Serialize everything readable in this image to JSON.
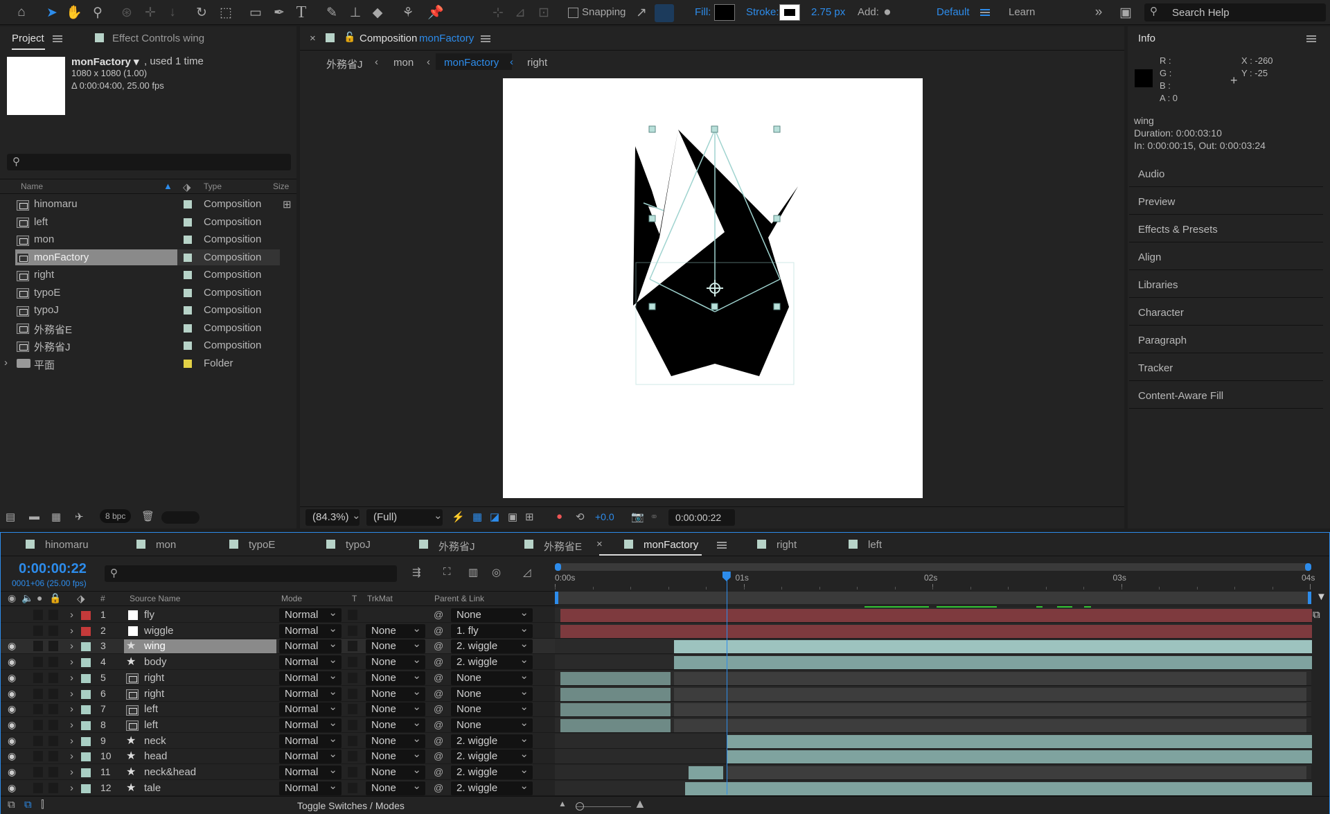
{
  "toolbar": {
    "snapping_label": "Snapping",
    "fill_label": "Fill:",
    "stroke_label": "Stroke:",
    "stroke_width": "2.75 px",
    "add_label": "Add:",
    "workspace": "Default",
    "learn_label": "Learn",
    "search_placeholder": "Search Help",
    "colors": {
      "accent": "#2d8ceb",
      "fill": "#000000",
      "stroke": "#ffffff"
    }
  },
  "project": {
    "tab_label": "Project",
    "effect_controls_label": "Effect Controls wing",
    "selected_name": "monFactory ▾",
    "used": ", used 1 time",
    "dims": "1080 x 1080 (1.00)",
    "duration": "Δ 0:00:04:00, 25.00 fps",
    "columns": {
      "name": "Name",
      "type": "Type",
      "size": "Size"
    },
    "items": [
      {
        "name": "hinomaru",
        "type": "Composition",
        "kind": "comp"
      },
      {
        "name": "left",
        "type": "Composition",
        "kind": "comp"
      },
      {
        "name": "mon",
        "type": "Composition",
        "kind": "comp"
      },
      {
        "name": "monFactory",
        "type": "Composition",
        "kind": "comp",
        "selected": true
      },
      {
        "name": "right",
        "type": "Composition",
        "kind": "comp"
      },
      {
        "name": "typoE",
        "type": "Composition",
        "kind": "comp"
      },
      {
        "name": "typoJ",
        "type": "Composition",
        "kind": "comp"
      },
      {
        "name": "外務省E",
        "type": "Composition",
        "kind": "comp"
      },
      {
        "name": "外務省J",
        "type": "Composition",
        "kind": "comp"
      },
      {
        "name": "平面",
        "type": "Folder",
        "kind": "folder"
      }
    ],
    "bpc": "8 bpc"
  },
  "composition": {
    "tab_prefix": "Composition",
    "tab_name": "monFactory",
    "breadcrumbs": [
      "外務省J",
      "mon",
      "monFactory",
      "right"
    ],
    "zoom": "(84.3%)",
    "resolution": "(Full)",
    "exposure": "+0.0",
    "timecode": "0:00:00:22"
  },
  "info": {
    "title": "Info",
    "r": "R :",
    "g": "G :",
    "b": "B :",
    "a": "A :  0",
    "x": "X : -260",
    "y": "Y :  -25",
    "layer": "wing",
    "duration": "Duration: 0:00:03:10",
    "inout": "In: 0:00:00:15, Out: 0:00:03:24",
    "panels": [
      "Audio",
      "Preview",
      "Effects & Presets",
      "Align",
      "Libraries",
      "Character",
      "Paragraph",
      "Tracker",
      "Content-Aware Fill"
    ]
  },
  "timeline": {
    "tabs": [
      "hinomaru",
      "mon",
      "typoE",
      "typoJ",
      "外務省J",
      "外務省E",
      "monFactory",
      "right",
      "left"
    ],
    "active_tab": "monFactory",
    "timecode": "0:00:00:22",
    "frame_info": "0001+06 (25.00 fps)",
    "columns": {
      "num": "#",
      "source": "Source Name",
      "mode": "Mode",
      "t": "T",
      "trkmat": "TrkMat",
      "parent": "Parent & Link"
    },
    "ruler": [
      "0:00s",
      "01s",
      "02s",
      "03s",
      "04s"
    ],
    "playhead_sec": 0.88,
    "duration_sec": 4,
    "toggle_label": "Toggle Switches / Modes",
    "layers": [
      {
        "num": "1",
        "name": "fly",
        "label_color": "#c43a3a",
        "icon": "solid",
        "mode": "Normal",
        "trkmat": "",
        "parent": "None",
        "visible": false,
        "start": 0,
        "end": 4,
        "bar_color": "#7e3a3e"
      },
      {
        "num": "2",
        "name": "wiggle",
        "label_color": "#c43a3a",
        "icon": "solid",
        "mode": "Normal",
        "trkmat": "None",
        "parent": "1. fly",
        "visible": false,
        "start": 0,
        "end": 4,
        "bar_color": "#7e3a3e"
      },
      {
        "num": "3",
        "name": "wing",
        "label_color": "#a9cfc4",
        "icon": "star",
        "mode": "Normal",
        "trkmat": "None",
        "parent": "2. wiggle",
        "visible": true,
        "selected": true,
        "start": 0.6,
        "end": 4,
        "bar_color": "#9dc3bf"
      },
      {
        "num": "4",
        "name": "body",
        "label_color": "#a9cfc4",
        "icon": "star",
        "mode": "Normal",
        "trkmat": "None",
        "parent": "2. wiggle",
        "visible": true,
        "start": 0.6,
        "end": 4,
        "bar_color": "#7fa39f"
      },
      {
        "num": "5",
        "name": "right",
        "label_color": "#a9cfc4",
        "icon": "comp",
        "mode": "Normal",
        "trkmat": "None",
        "parent": "None",
        "visible": true,
        "start": 0,
        "end": 0.6,
        "bar_color": "#6e8a86"
      },
      {
        "num": "6",
        "name": "right",
        "label_color": "#a9cfc4",
        "icon": "comp",
        "mode": "Normal",
        "trkmat": "None",
        "parent": "None",
        "visible": true,
        "start": 0,
        "end": 0.6,
        "bar_color": "#6e8a86"
      },
      {
        "num": "7",
        "name": "left",
        "label_color": "#a9cfc4",
        "icon": "comp",
        "mode": "Normal",
        "trkmat": "None",
        "parent": "None",
        "visible": true,
        "start": 0,
        "end": 0.6,
        "bar_color": "#6e8a86"
      },
      {
        "num": "8",
        "name": "left",
        "label_color": "#a9cfc4",
        "icon": "comp",
        "mode": "Normal",
        "trkmat": "None",
        "parent": "None",
        "visible": true,
        "start": 0,
        "end": 0.6,
        "bar_color": "#6e8a86"
      },
      {
        "num": "9",
        "name": "neck",
        "label_color": "#a9cfc4",
        "icon": "star",
        "mode": "Normal",
        "trkmat": "None",
        "parent": "2. wiggle",
        "visible": true,
        "start": 0.88,
        "end": 4,
        "bar_color": "#7fa39f"
      },
      {
        "num": "10",
        "name": "head",
        "label_color": "#a9cfc4",
        "icon": "star",
        "mode": "Normal",
        "trkmat": "None",
        "parent": "2. wiggle",
        "visible": true,
        "start": 0.88,
        "end": 4,
        "bar_color": "#7fa39f"
      },
      {
        "num": "11",
        "name": "neck&head",
        "label_color": "#a9cfc4",
        "icon": "star",
        "mode": "Normal",
        "trkmat": "None",
        "parent": "2. wiggle",
        "visible": true,
        "start": 0.68,
        "end": 0.88,
        "bar_color": "#7fa39f"
      },
      {
        "num": "12",
        "name": "tale",
        "label_color": "#a9cfc4",
        "icon": "star",
        "mode": "Normal",
        "trkmat": "None",
        "parent": "2. wiggle",
        "visible": true,
        "start": 0.66,
        "end": 4,
        "bar_color": "#7fa39f"
      }
    ]
  }
}
